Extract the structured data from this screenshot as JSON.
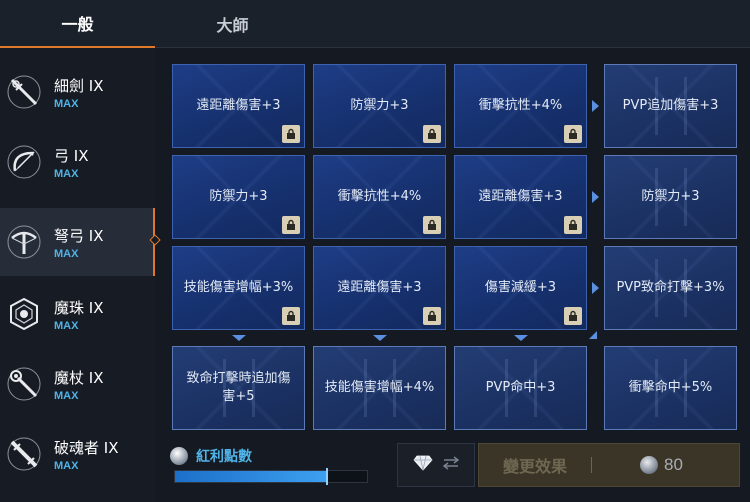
{
  "tabs": [
    {
      "label": "一般"
    },
    {
      "label": "大師"
    }
  ],
  "weapons": [
    {
      "name": "細劍 IX",
      "level": "MAX",
      "icon": "rapier-icon"
    },
    {
      "name": "弓 IX",
      "level": "MAX",
      "icon": "bow-icon"
    },
    {
      "name": "弩弓 IX",
      "level": "MAX",
      "icon": "crossbow-icon"
    },
    {
      "name": "魔珠 IX",
      "level": "MAX",
      "icon": "orb-icon"
    },
    {
      "name": "魔杖 IX",
      "level": "MAX",
      "icon": "wand-icon"
    },
    {
      "name": "破魂者 IX",
      "level": "MAX",
      "icon": "soulbreaker-icon"
    }
  ],
  "grid": [
    [
      "遠距離傷害+3",
      "防禦力+3",
      "衝擊抗性+4%",
      "PVP追加傷害+3"
    ],
    [
      "防禦力+3",
      "衝擊抗性+4%",
      "遠距離傷害+3",
      "防禦力+3"
    ],
    [
      "技能傷害增幅+3%",
      "遠距離傷害+3",
      "傷害減緩+3",
      "PVP致命打擊+3%"
    ],
    [
      "致命打擊時追加傷害+5",
      "技能傷害增幅+4%",
      "PVP命中+3",
      "衝擊命中+5%"
    ]
  ],
  "bonus": {
    "label": "紅利點數",
    "progress": 0.79
  },
  "change": {
    "label": "變更效果",
    "cost": "80"
  },
  "colors": {
    "accent": "#e07a2a",
    "link_blue": "#4fb3e8",
    "card_blue": "#1e3d86"
  }
}
